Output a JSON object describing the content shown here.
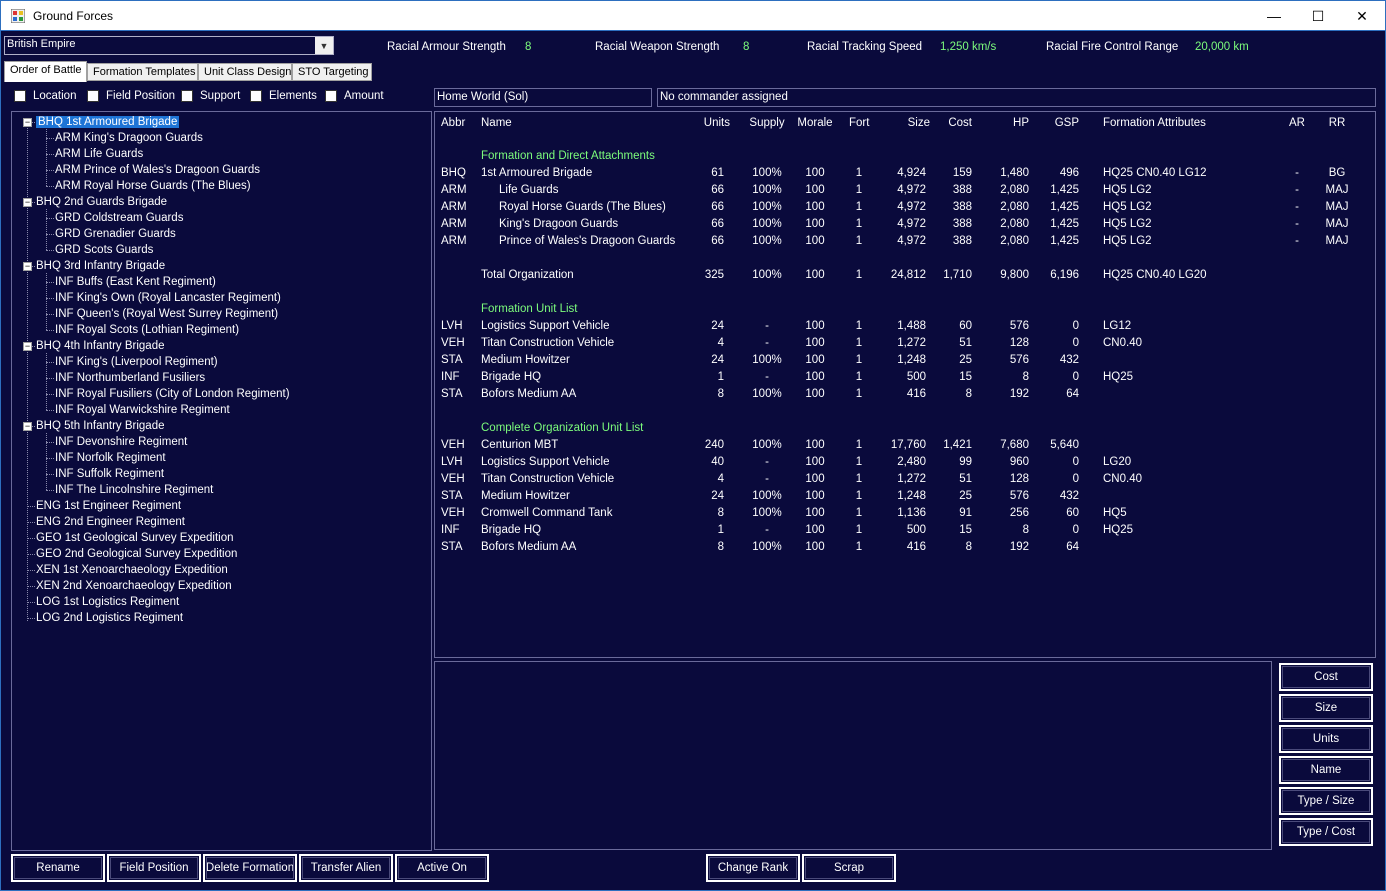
{
  "window": {
    "title": "Ground Forces",
    "minimize": "—",
    "maximize": "☐",
    "close": "✕"
  },
  "empire_select": {
    "value": "British Empire"
  },
  "racial": {
    "armour_label": "Racial Armour Strength",
    "armour_value": "8",
    "weapon_label": "Racial Weapon Strength",
    "weapon_value": "8",
    "tracking_label": "Racial Tracking Speed",
    "tracking_value": "1,250 km/s",
    "fire_label": "Racial Fire Control Range",
    "fire_value": "20,000 km"
  },
  "tabs": [
    "Order of Battle",
    "Formation Templates",
    "Unit Class Design",
    "STO Targeting"
  ],
  "filters": [
    "Location",
    "Field Position",
    "Support",
    "Elements",
    "Amount"
  ],
  "location_box": "Home World  (Sol)",
  "commander_box": "No commander assigned",
  "tree": [
    {
      "label": "BHQ 1st Armoured Brigade",
      "level": 0,
      "expand": "−",
      "selected": true
    },
    {
      "label": "ARM King's Dragoon Guards",
      "level": 1
    },
    {
      "label": "ARM Life Guards",
      "level": 1
    },
    {
      "label": "ARM Prince of Wales's Dragoon Guards",
      "level": 1
    },
    {
      "label": "ARM Royal Horse Guards (The Blues)",
      "level": 1
    },
    {
      "label": "BHQ 2nd Guards Brigade",
      "level": 0,
      "expand": "−"
    },
    {
      "label": "GRD Coldstream Guards",
      "level": 1
    },
    {
      "label": "GRD Grenadier Guards",
      "level": 1
    },
    {
      "label": "GRD Scots Guards",
      "level": 1
    },
    {
      "label": "BHQ 3rd Infantry Brigade",
      "level": 0,
      "expand": "−"
    },
    {
      "label": "INF Buffs (East Kent Regiment)",
      "level": 1
    },
    {
      "label": "INF King's Own (Royal Lancaster Regiment)",
      "level": 1
    },
    {
      "label": "INF Queen's (Royal West Surrey Regiment)",
      "level": 1
    },
    {
      "label": "INF Royal Scots (Lothian Regiment)",
      "level": 1
    },
    {
      "label": "BHQ 4th Infantry Brigade",
      "level": 0,
      "expand": "−"
    },
    {
      "label": "INF King's (Liverpool Regiment)",
      "level": 1
    },
    {
      "label": "INF Northumberland Fusiliers",
      "level": 1
    },
    {
      "label": "INF Royal Fusiliers (City of London Regiment)",
      "level": 1
    },
    {
      "label": "INF Royal Warwickshire Regiment",
      "level": 1
    },
    {
      "label": "BHQ 5th Infantry Brigade",
      "level": 0,
      "expand": "−"
    },
    {
      "label": "INF Devonshire Regiment",
      "level": 1
    },
    {
      "label": "INF Norfolk Regiment",
      "level": 1
    },
    {
      "label": "INF Suffolk Regiment",
      "level": 1
    },
    {
      "label": "INF The Lincolnshire Regiment",
      "level": 1
    },
    {
      "label": "ENG 1st Engineer Regiment",
      "level": 0
    },
    {
      "label": "ENG 2nd Engineer Regiment",
      "level": 0
    },
    {
      "label": "GEO 1st Geological Survey Expedition",
      "level": 0
    },
    {
      "label": "GEO 2nd Geological Survey Expedition",
      "level": 0
    },
    {
      "label": "XEN 1st Xenoarchaeology Expedition",
      "level": 0
    },
    {
      "label": "XEN 2nd Xenoarchaeology Expedition",
      "level": 0
    },
    {
      "label": "LOG 1st Logistics Regiment",
      "level": 0
    },
    {
      "label": "LOG 2nd Logistics Regiment",
      "level": 0
    }
  ],
  "grid": {
    "headers": [
      "Abbr",
      "Name",
      "Units",
      "Supply",
      "Morale",
      "Fort",
      "Size",
      "Cost",
      "HP",
      "GSP",
      "Formation Attributes",
      "AR",
      "RR"
    ],
    "rows": [
      {
        "type": "section",
        "name": "Formation and Direct Attachments"
      },
      {
        "type": "data",
        "abbr": "BHQ",
        "name": "1st Armoured Brigade",
        "indent": false,
        "units": "61",
        "supply": "100%",
        "morale": "100",
        "fort": "1",
        "size": "4,924",
        "cost": "159",
        "hp": "1,480",
        "gsp": "496",
        "attr": "HQ25  CN0.40  LG12",
        "ar": "-",
        "rr": "BG"
      },
      {
        "type": "data",
        "abbr": "ARM",
        "name": "Life Guards",
        "indent": true,
        "units": "66",
        "supply": "100%",
        "morale": "100",
        "fort": "1",
        "size": "4,972",
        "cost": "388",
        "hp": "2,080",
        "gsp": "1,425",
        "attr": "HQ5  LG2",
        "ar": "-",
        "rr": "MAJ"
      },
      {
        "type": "data",
        "abbr": "ARM",
        "name": "Royal Horse Guards (The Blues)",
        "indent": true,
        "units": "66",
        "supply": "100%",
        "morale": "100",
        "fort": "1",
        "size": "4,972",
        "cost": "388",
        "hp": "2,080",
        "gsp": "1,425",
        "attr": "HQ5  LG2",
        "ar": "-",
        "rr": "MAJ"
      },
      {
        "type": "data",
        "abbr": "ARM",
        "name": "King's Dragoon Guards",
        "indent": true,
        "units": "66",
        "supply": "100%",
        "morale": "100",
        "fort": "1",
        "size": "4,972",
        "cost": "388",
        "hp": "2,080",
        "gsp": "1,425",
        "attr": "HQ5  LG2",
        "ar": "-",
        "rr": "MAJ"
      },
      {
        "type": "data",
        "abbr": "ARM",
        "name": "Prince of Wales's Dragoon Guards",
        "indent": true,
        "units": "66",
        "supply": "100%",
        "morale": "100",
        "fort": "1",
        "size": "4,972",
        "cost": "388",
        "hp": "2,080",
        "gsp": "1,425",
        "attr": "HQ5  LG2",
        "ar": "-",
        "rr": "MAJ"
      },
      {
        "type": "blank"
      },
      {
        "type": "data",
        "abbr": "",
        "name": "Total Organization",
        "indent": false,
        "units": "325",
        "supply": "100%",
        "morale": "100",
        "fort": "1",
        "size": "24,812",
        "cost": "1,710",
        "hp": "9,800",
        "gsp": "6,196",
        "attr": "HQ25  CN0.40  LG20",
        "ar": "",
        "rr": ""
      },
      {
        "type": "blank"
      },
      {
        "type": "section",
        "name": "Formation Unit List"
      },
      {
        "type": "data",
        "abbr": "LVH",
        "name": "Logistics Support Vehicle",
        "indent": false,
        "units": "24",
        "supply": "-",
        "morale": "100",
        "fort": "1",
        "size": "1,488",
        "cost": "60",
        "hp": "576",
        "gsp": "0",
        "attr": "LG12",
        "ar": "",
        "rr": ""
      },
      {
        "type": "data",
        "abbr": "VEH",
        "name": "Titan Construction Vehicle",
        "indent": false,
        "units": "4",
        "supply": "-",
        "morale": "100",
        "fort": "1",
        "size": "1,272",
        "cost": "51",
        "hp": "128",
        "gsp": "0",
        "attr": "CN0.40",
        "ar": "",
        "rr": ""
      },
      {
        "type": "data",
        "abbr": "STA",
        "name": "Medium Howitzer",
        "indent": false,
        "units": "24",
        "supply": "100%",
        "morale": "100",
        "fort": "1",
        "size": "1,248",
        "cost": "25",
        "hp": "576",
        "gsp": "432",
        "attr": "",
        "ar": "",
        "rr": ""
      },
      {
        "type": "data",
        "abbr": "INF",
        "name": "Brigade HQ",
        "indent": false,
        "units": "1",
        "supply": "-",
        "morale": "100",
        "fort": "1",
        "size": "500",
        "cost": "15",
        "hp": "8",
        "gsp": "0",
        "attr": "HQ25",
        "ar": "",
        "rr": ""
      },
      {
        "type": "data",
        "abbr": "STA",
        "name": "Bofors Medium AA",
        "indent": false,
        "units": "8",
        "supply": "100%",
        "morale": "100",
        "fort": "1",
        "size": "416",
        "cost": "8",
        "hp": "192",
        "gsp": "64",
        "attr": "",
        "ar": "",
        "rr": ""
      },
      {
        "type": "blank"
      },
      {
        "type": "section",
        "name": "Complete Organization Unit List"
      },
      {
        "type": "data",
        "abbr": "VEH",
        "name": "Centurion MBT",
        "indent": false,
        "units": "240",
        "supply": "100%",
        "morale": "100",
        "fort": "1",
        "size": "17,760",
        "cost": "1,421",
        "hp": "7,680",
        "gsp": "5,640",
        "attr": "",
        "ar": "",
        "rr": ""
      },
      {
        "type": "data",
        "abbr": "LVH",
        "name": "Logistics Support Vehicle",
        "indent": false,
        "units": "40",
        "supply": "-",
        "morale": "100",
        "fort": "1",
        "size": "2,480",
        "cost": "99",
        "hp": "960",
        "gsp": "0",
        "attr": "LG20",
        "ar": "",
        "rr": ""
      },
      {
        "type": "data",
        "abbr": "VEH",
        "name": "Titan Construction Vehicle",
        "indent": false,
        "units": "4",
        "supply": "-",
        "morale": "100",
        "fort": "1",
        "size": "1,272",
        "cost": "51",
        "hp": "128",
        "gsp": "0",
        "attr": "CN0.40",
        "ar": "",
        "rr": ""
      },
      {
        "type": "data",
        "abbr": "STA",
        "name": "Medium Howitzer",
        "indent": false,
        "units": "24",
        "supply": "100%",
        "morale": "100",
        "fort": "1",
        "size": "1,248",
        "cost": "25",
        "hp": "576",
        "gsp": "432",
        "attr": "",
        "ar": "",
        "rr": ""
      },
      {
        "type": "data",
        "abbr": "VEH",
        "name": "Cromwell Command Tank",
        "indent": false,
        "units": "8",
        "supply": "100%",
        "morale": "100",
        "fort": "1",
        "size": "1,136",
        "cost": "91",
        "hp": "256",
        "gsp": "60",
        "attr": "HQ5",
        "ar": "",
        "rr": ""
      },
      {
        "type": "data",
        "abbr": "INF",
        "name": "Brigade HQ",
        "indent": false,
        "units": "1",
        "supply": "-",
        "morale": "100",
        "fort": "1",
        "size": "500",
        "cost": "15",
        "hp": "8",
        "gsp": "0",
        "attr": "HQ25",
        "ar": "",
        "rr": ""
      },
      {
        "type": "data",
        "abbr": "STA",
        "name": "Bofors Medium AA",
        "indent": false,
        "units": "8",
        "supply": "100%",
        "morale": "100",
        "fort": "1",
        "size": "416",
        "cost": "8",
        "hp": "192",
        "gsp": "64",
        "attr": "",
        "ar": "",
        "rr": ""
      }
    ]
  },
  "sort_buttons": [
    "Cost",
    "Size",
    "Units",
    "Name",
    "Type / Size",
    "Type / Cost"
  ],
  "bottom_buttons": [
    "Rename",
    "Field Position",
    "Delete Formation",
    "Transfer Alien",
    "Active On",
    "Change Rank",
    "Scrap"
  ],
  "colors": {
    "background": "#0a0a3c",
    "accent_green": "#7cfc7c",
    "selection": "#1e74d6"
  }
}
